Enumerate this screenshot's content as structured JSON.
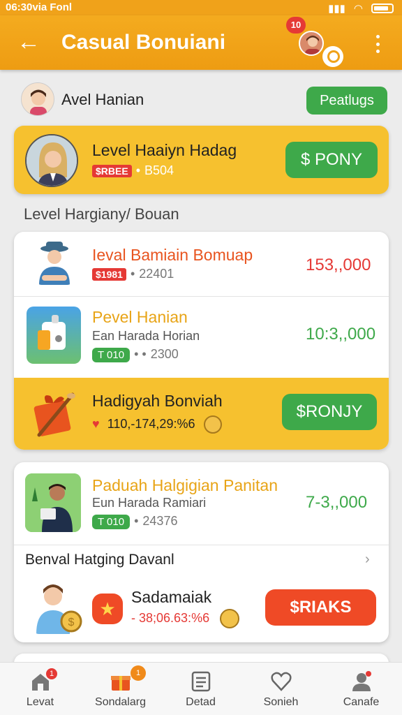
{
  "status_bar": {
    "time": "06:30via Fonl"
  },
  "app_bar": {
    "title": "Casual Bonuiani",
    "notification_count": "10"
  },
  "profile": {
    "name": "Avel Hanian",
    "button_label": "Peatlugs"
  },
  "featured": {
    "title": "Level Haaiyn Hadag",
    "tag": "$RBEE",
    "meta": "B504",
    "button_label": "$ PONY"
  },
  "section_title": "Level Hargiany/ Bouan",
  "list_items": [
    {
      "title": "Ieval Bamiain Bomuap",
      "tag": "$1981",
      "meta": "22401",
      "price": "153,,000"
    },
    {
      "title": "Pevel Hanian",
      "subtitle": "Ean Harada Horian",
      "tag": "T 010",
      "meta": "2300",
      "price": "10:3,,000"
    }
  ],
  "promo": {
    "title": "Hadigyah Bonviah",
    "meta": "110,-174,29:%6",
    "button_label": "$RONJY"
  },
  "card2": {
    "item": {
      "title": "Paduah Halgigian Panitan",
      "subtitle": "Eun Harada Ramiari",
      "tag": "T 010",
      "meta": "24376",
      "price": "7-3,,000"
    },
    "section_title": "Benval Hatging Davanl",
    "offer": {
      "title": "Sadamaiak",
      "meta": "- 38;06.63:%6",
      "button_label": "$RIAKS"
    }
  },
  "bottom_nav": [
    {
      "label": "Levat",
      "badge": "1"
    },
    {
      "label": "Sondalarg",
      "badge": "1"
    },
    {
      "label": "Detad"
    },
    {
      "label": "Sonieh"
    },
    {
      "label": "Canafe"
    }
  ],
  "colors": {
    "app_bar": "#f0a21a",
    "green": "#3ea94a",
    "red": "#e53935",
    "yellow_band": "#f6c12f"
  }
}
